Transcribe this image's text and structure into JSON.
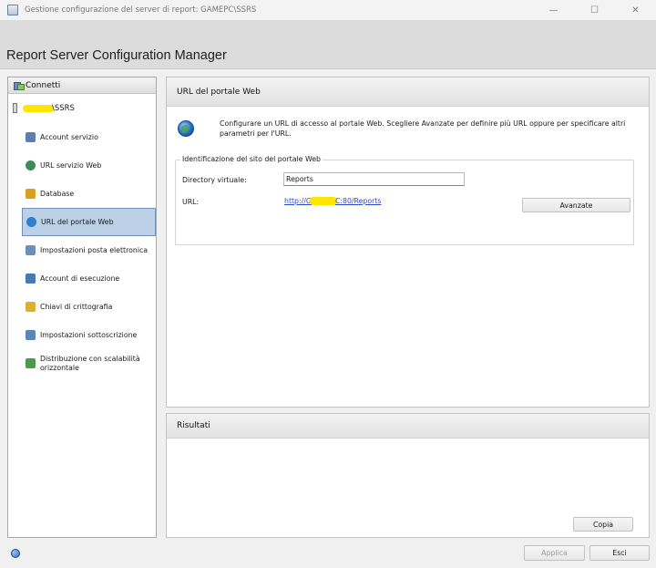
{
  "window": {
    "title": "Gestione configurazione del server di report: GAMEPC\\SSRS",
    "minimize_glyph": "—",
    "maximize_glyph": "☐",
    "close_glyph": "✕"
  },
  "header": {
    "app_title": "Report Server Configuration Manager"
  },
  "sidebar": {
    "connect_label": "Connetti",
    "server_label": "\\SSRS",
    "items": [
      {
        "label": "Account servizio",
        "icon": "service-account-icon",
        "color": "#5b7fae"
      },
      {
        "label": "URL servizio Web",
        "icon": "web-service-url-icon",
        "color": "#3c8c5a"
      },
      {
        "label": "Database",
        "icon": "database-icon",
        "color": "#d9a020"
      },
      {
        "label": "URL del portale Web",
        "icon": "web-portal-url-icon",
        "color": "#2e7fd0",
        "selected": true
      },
      {
        "label": "Impostazioni posta elettronica",
        "icon": "email-settings-icon",
        "color": "#6c8fb8"
      },
      {
        "label": "Account di esecuzione",
        "icon": "execution-account-icon",
        "color": "#4a78b3"
      },
      {
        "label": "Chiavi di crittografia",
        "icon": "encryption-keys-icon",
        "color": "#d9b030"
      },
      {
        "label": "Impostazioni sottoscrizione",
        "icon": "subscription-settings-icon",
        "color": "#5a86b8"
      },
      {
        "label": "Distribuzione con scalabilità orizzontale",
        "icon": "scale-out-icon",
        "color": "#4a9a4a"
      }
    ]
  },
  "main": {
    "section_title": "URL del portale Web",
    "description": "Configurare un URL di accesso al portale Web. Scegliere Avanzate per definire più URL oppure per specificare altri parametri per l'URL.",
    "group_title": "Identificazione del sito del portale Web",
    "virtual_dir_label": "Directory virtuale:",
    "virtual_dir_value": "Reports",
    "url_label": "URL:",
    "url_prefix": "http://G",
    "url_suffix": "C:80/Reports",
    "advanced_button": "Avanzate"
  },
  "results": {
    "title": "Risultati",
    "copy_button": "Copia"
  },
  "footer": {
    "apply_button": "Applica",
    "exit_button": "Esci"
  }
}
